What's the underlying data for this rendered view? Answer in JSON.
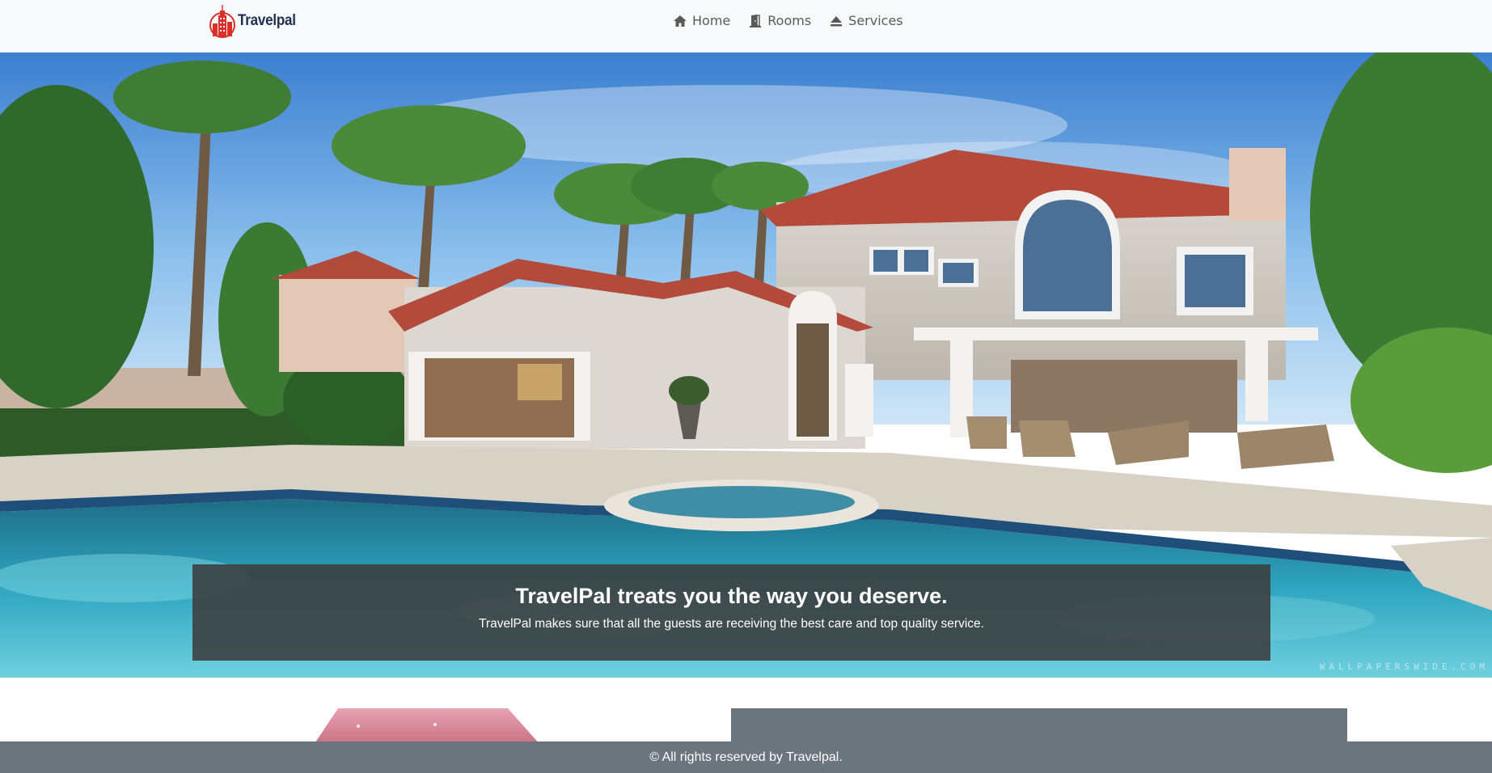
{
  "brand": {
    "name": "Travelpal",
    "logo": "skyscraper-logo",
    "accent": "#d9302c",
    "text_color": "#1e2f52"
  },
  "nav": {
    "items": [
      {
        "label": "Home",
        "icon": "home-icon"
      },
      {
        "label": "Rooms",
        "icon": "door-icon"
      },
      {
        "label": "Services",
        "icon": "eject-icon"
      }
    ]
  },
  "hero": {
    "title": "TravelPal treats you the way you deserve.",
    "subtitle": "TravelPal makes sure that all the guests are receiving the best care and top quality service.",
    "watermark": "WALLPAPERSWIDE.COM"
  },
  "footer": {
    "text": "© All rights reserved by Travelpal."
  },
  "colors": {
    "navbar_bg": "#f8f9fa",
    "footer_bg": "#6c757d",
    "caption_bg": "#3c3c3c"
  }
}
